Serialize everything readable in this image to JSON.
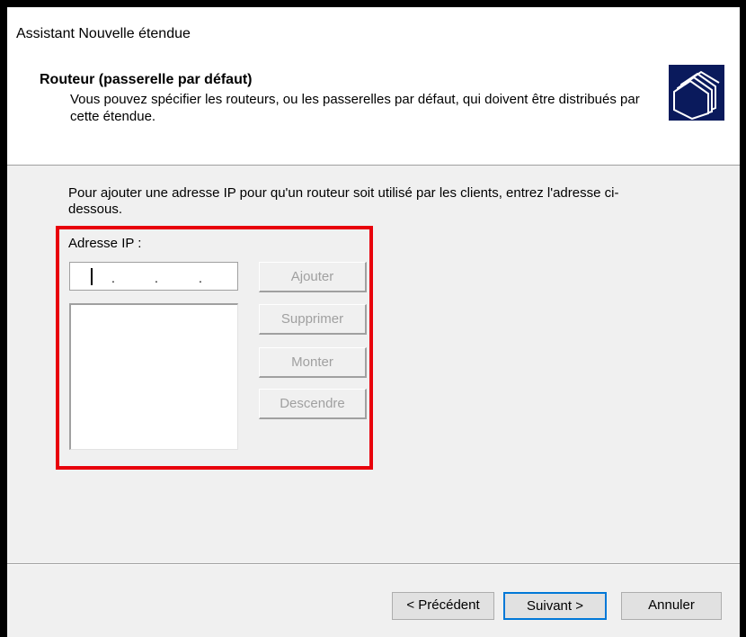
{
  "window": {
    "title": "Assistant Nouvelle étendue"
  },
  "header": {
    "title": "Routeur (passerelle par défaut)",
    "description": "Vous pouvez spécifier les routeurs, ou les passerelles par défaut, qui doivent être distribués par cette étendue.",
    "icon": "folders-icon"
  },
  "body": {
    "instruction": "Pour ajouter une adresse IP pour qu'un routeur soit utilisé par les clients, entrez l'adresse ci-dessous.",
    "ip_label": "Adresse IP :",
    "ip_dots": [
      ".",
      ".",
      "."
    ]
  },
  "buttons": {
    "add": "Ajouter",
    "remove": "Supprimer",
    "up": "Monter",
    "down": "Descendre"
  },
  "nav": {
    "back": "< Précédent",
    "next": "Suivant >",
    "cancel": "Annuler"
  },
  "colors": {
    "highlight": "#e8000b",
    "default_button_border": "#0078d7",
    "disabled_text": "#a0a0a0"
  }
}
